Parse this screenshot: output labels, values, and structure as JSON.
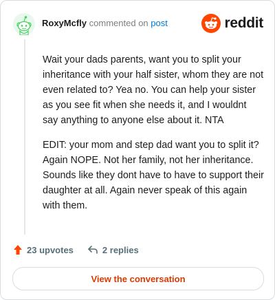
{
  "header": {
    "username": "RoxyMcfly",
    "verb": "commented on",
    "post_link": "post",
    "brand": "reddit"
  },
  "comment": {
    "paragraphs": [
      "Wait your dads parents, want you to split your inheritance with your half sister, whom they are not even related to? Yea no. You can help your sister as you see fit when she needs it, and I wouldnt say anything to anyone else about it. NTA",
      "EDIT: your mom and step dad want you to split it? Again NOPE. Not her family, not her inheritance. Sounds like they dont have to have to support their daughter at all. Again never speak of this again with them."
    ]
  },
  "stats": {
    "upvotes": "23 upvotes",
    "replies": "2 replies"
  },
  "actions": {
    "view_conversation": "View the conversation"
  },
  "colors": {
    "brand_orange": "#ff4500",
    "link_blue": "#0079d3",
    "button_text": "#d93a00",
    "avatar_green": "#46d160"
  },
  "icons": {
    "avatar": "snoo-avatar-icon",
    "brand": "reddit-logo-icon",
    "upvote": "upvote-arrow-icon",
    "reply": "reply-arrow-icon"
  }
}
